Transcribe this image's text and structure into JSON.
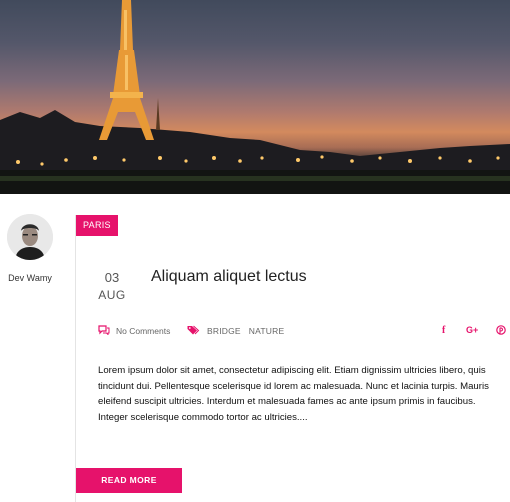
{
  "hero": {
    "alt_icon": "eiffel-tower-night-photo"
  },
  "author": {
    "name": "Dev Wamy"
  },
  "post": {
    "category": "PARIS",
    "date_day": "03",
    "date_month": "AUG",
    "title": "Aliquam aliquet lectus",
    "comments_label": "No Comments",
    "tags": [
      "BRIDGE",
      "NATURE"
    ],
    "excerpt": "Lorem ipsum dolor sit amet, consectetur adipiscing elit. Etiam dignissim ultricies libero, quis tincidunt dui. Pellentesque scelerisque id lorem ac malesuada. Nunc et lacinia turpis. Mauris eleifend suscipit ultricies. Interdum et malesuada fames ac ante ipsum primis in faucibus. Integer scelerisque commodo tortor ac ultricies....",
    "read_more": "READ MORE"
  },
  "share": {
    "facebook": "f",
    "googleplus": "G+",
    "pinterest": "℗"
  },
  "colors": {
    "accent": "#e6126b"
  }
}
